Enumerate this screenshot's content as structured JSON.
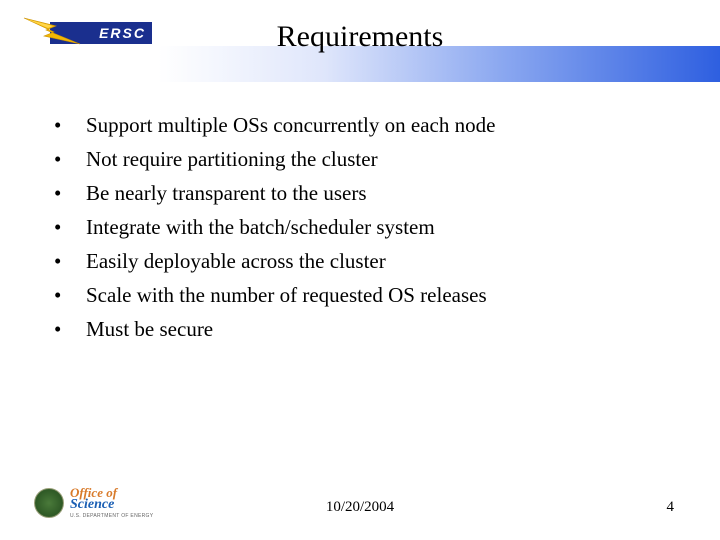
{
  "title": "Requirements",
  "logo_top": {
    "text": "ERSC",
    "bolt_color": "#f2b705",
    "badge_color": "#1a2f8e"
  },
  "bullets": [
    "Support multiple OSs concurrently on each node",
    "Not require partitioning the cluster",
    "Be nearly transparent to the users",
    "Integrate with the batch/scheduler system",
    "Easily deployable across the cluster",
    "Scale with the number of requested OS releases",
    "Must be secure"
  ],
  "footer": {
    "date": "10/20/2004",
    "page": "4"
  },
  "logo_bottom": {
    "line1": "Office of",
    "line2": "Science",
    "line3": "U.S. DEPARTMENT OF ENERGY"
  }
}
